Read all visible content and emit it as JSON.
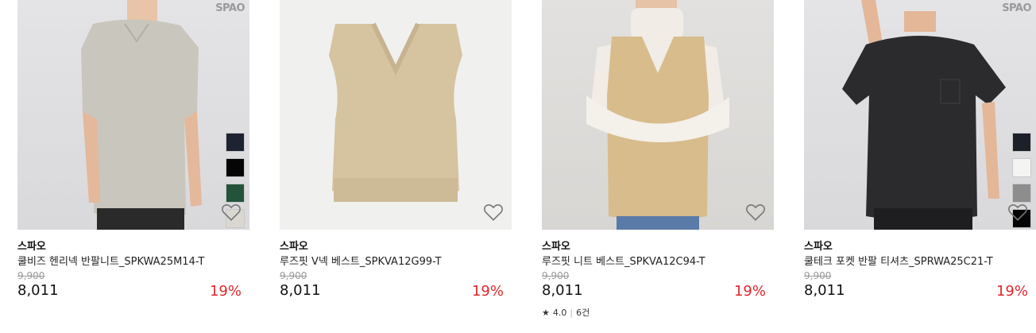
{
  "products": [
    {
      "brand": "스파오",
      "name": "쿨비즈 헨리넥 반팔니트_SPKWA25M14-T",
      "original_price": "9,900",
      "price": "8,011",
      "discount": "19%",
      "brand_logo": "SPAO",
      "swatches": [
        "#1d2330",
        "#050505",
        "#23543a",
        "#d9d7cf"
      ],
      "wishlist_icon": "heart-outline-icon"
    },
    {
      "brand": "스파오",
      "name": "루즈핏 V넥 베스트_SPKVA12G99-T",
      "original_price": "9,900",
      "price": "8,011",
      "discount": "19%",
      "wishlist_icon": "heart-outline-icon"
    },
    {
      "brand": "스파오",
      "name": "루즈핏 니트 베스트_SPKVA12C94-T",
      "original_price": "9,900",
      "price": "8,011",
      "discount": "19%",
      "rating": "4.0",
      "reviews": "6건",
      "wishlist_icon": "heart-outline-icon"
    },
    {
      "brand": "스파오",
      "name": "쿨테크 포켓 반팔 티셔츠_SPRWA25C21-T",
      "original_price": "9,900",
      "price": "8,011",
      "discount": "19%",
      "brand_logo": "SPAO",
      "swatches": [
        "#1b2029",
        "#f4f4f2",
        "#8d8d8d",
        "#050505"
      ],
      "wishlist_icon": "heart-outline-icon"
    }
  ],
  "colors": {
    "discount": "#e0262c",
    "strike_price": "#999999"
  }
}
